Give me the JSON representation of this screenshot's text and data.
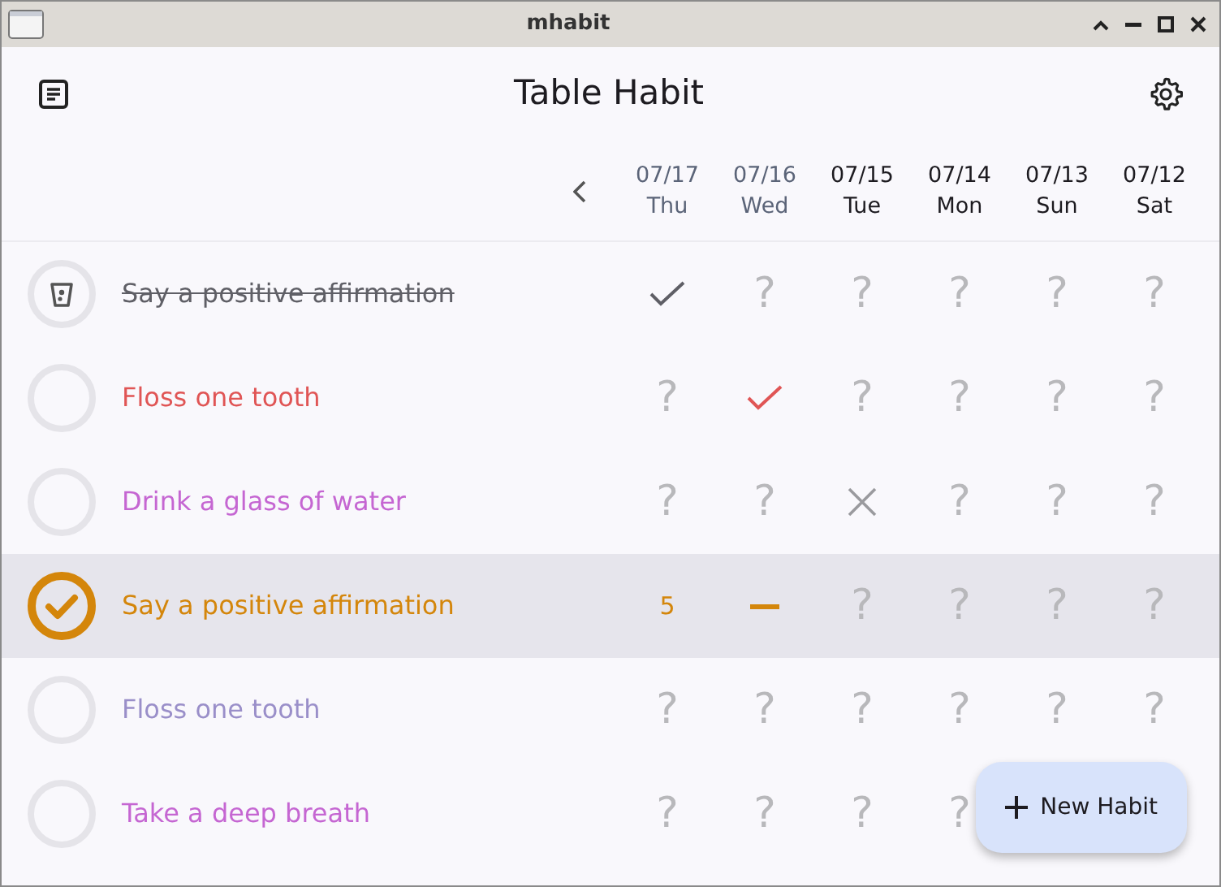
{
  "window": {
    "title": "mhabit"
  },
  "app_bar": {
    "title": "Table Habit"
  },
  "days": [
    {
      "date": "07/17",
      "weekday": "Thu",
      "muted": true
    },
    {
      "date": "07/16",
      "weekday": "Wed",
      "muted": true
    },
    {
      "date": "07/15",
      "weekday": "Tue",
      "muted": false
    },
    {
      "date": "07/14",
      "weekday": "Mon",
      "muted": false
    },
    {
      "date": "07/13",
      "weekday": "Sun",
      "muted": false
    },
    {
      "date": "07/12",
      "weekday": "Sat",
      "muted": false
    }
  ],
  "habits": [
    {
      "name": "Say a positive affirmation",
      "color": "#5f5f66",
      "kind": "cup",
      "struck": true,
      "selected": false,
      "cells": [
        {
          "kind": "check"
        },
        {
          "kind": "unknown",
          "text": "?"
        },
        {
          "kind": "unknown",
          "text": "?"
        },
        {
          "kind": "unknown",
          "text": "?"
        },
        {
          "kind": "unknown",
          "text": "?"
        },
        {
          "kind": "unknown",
          "text": "?"
        }
      ]
    },
    {
      "name": "Floss one tooth",
      "color": "#e05555",
      "kind": "empty",
      "struck": false,
      "selected": false,
      "cells": [
        {
          "kind": "unknown",
          "text": "?"
        },
        {
          "kind": "check"
        },
        {
          "kind": "unknown",
          "text": "?"
        },
        {
          "kind": "unknown",
          "text": "?"
        },
        {
          "kind": "unknown",
          "text": "?"
        },
        {
          "kind": "unknown",
          "text": "?"
        }
      ]
    },
    {
      "name": "Drink a glass of water",
      "color": "#c566d2",
      "kind": "empty",
      "struck": false,
      "selected": false,
      "cells": [
        {
          "kind": "unknown",
          "text": "?"
        },
        {
          "kind": "unknown",
          "text": "?"
        },
        {
          "kind": "skip"
        },
        {
          "kind": "unknown",
          "text": "?"
        },
        {
          "kind": "unknown",
          "text": "?"
        },
        {
          "kind": "unknown",
          "text": "?"
        }
      ]
    },
    {
      "name": "Say a positive affirmation",
      "color": "#d4860b",
      "kind": "done",
      "struck": false,
      "selected": true,
      "cells": [
        {
          "kind": "count",
          "text": "5"
        },
        {
          "kind": "partial"
        },
        {
          "kind": "unknown",
          "text": "?"
        },
        {
          "kind": "unknown",
          "text": "?"
        },
        {
          "kind": "unknown",
          "text": "?"
        },
        {
          "kind": "unknown",
          "text": "?"
        }
      ]
    },
    {
      "name": "Floss one tooth",
      "color": "#9a8fc9",
      "kind": "empty",
      "struck": false,
      "selected": false,
      "cells": [
        {
          "kind": "unknown",
          "text": "?"
        },
        {
          "kind": "unknown",
          "text": "?"
        },
        {
          "kind": "unknown",
          "text": "?"
        },
        {
          "kind": "unknown",
          "text": "?"
        },
        {
          "kind": "unknown",
          "text": "?"
        },
        {
          "kind": "unknown",
          "text": "?"
        }
      ]
    },
    {
      "name": "Take a deep breath",
      "color": "#c566d2",
      "kind": "empty",
      "struck": false,
      "selected": false,
      "cells": [
        {
          "kind": "unknown",
          "text": "?"
        },
        {
          "kind": "unknown",
          "text": "?"
        },
        {
          "kind": "unknown",
          "text": "?"
        },
        {
          "kind": "unknown",
          "text": "?"
        }
      ]
    }
  ],
  "fab": {
    "label": "New Habit"
  }
}
